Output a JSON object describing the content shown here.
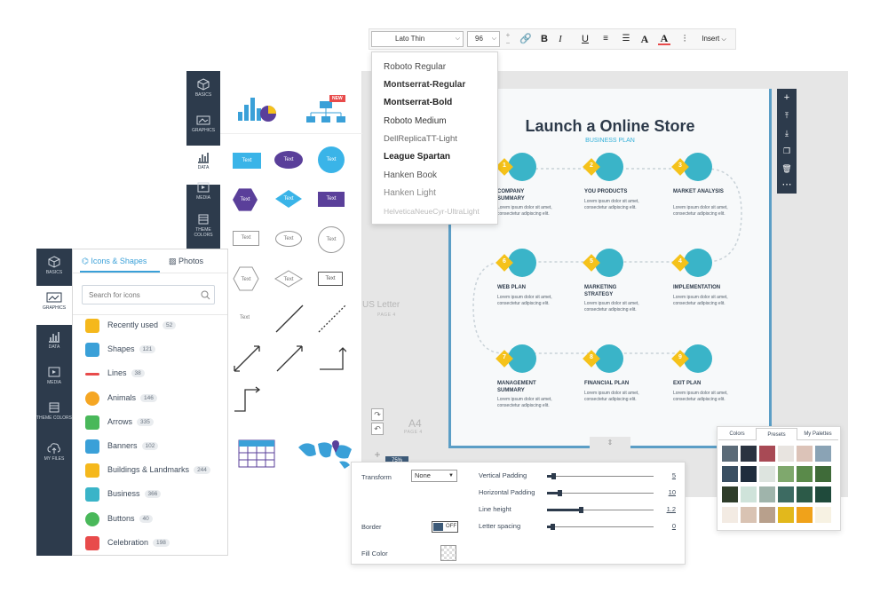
{
  "toolbar": {
    "font_value": "Lato Thin",
    "size_value": "96",
    "bold": "B",
    "italic": "I",
    "underline": "U",
    "text_color": "A",
    "highlight": "A",
    "insert_label": "Insert"
  },
  "font_menu": {
    "items": [
      "Roboto Regular",
      "Montserrat-Regular",
      "Montserrat-Bold",
      "Roboto Medium",
      "DellReplicaTT-Light",
      "League Spartan",
      "Hanken Book",
      "Hanken Light",
      "HelveticaNeueCyr-UltraLight"
    ]
  },
  "back_sidebar": {
    "tabs": [
      "BASICS",
      "GRAPHICS",
      "DATA",
      "MEDIA",
      "THEME COLORS"
    ]
  },
  "shape_panel": {
    "new_badge": "NEW",
    "shape_text": "Text",
    "zoom": "75%"
  },
  "canvas": {
    "letter_label": "US Letter",
    "letter_sub": "PAGE 4",
    "a4_label": "A4",
    "a4_sub": "PAGE 4"
  },
  "infographic": {
    "title": "Launch a Online Store",
    "subtitle": "BUSINESS PLAN",
    "body_text": "Lorem ipsum dolor sit amet, consectetur adipiscing elit.",
    "steps": [
      {
        "num": "1",
        "title": "COMPANY SUMMARY"
      },
      {
        "num": "2",
        "title": "YOU PRODUCTS"
      },
      {
        "num": "3",
        "title": "MARKET ANALYSIS"
      },
      {
        "num": "6",
        "title": "WEB PLAN"
      },
      {
        "num": "5",
        "title": "MARKETING STRATEGY"
      },
      {
        "num": "4",
        "title": "IMPLEMENTATION"
      },
      {
        "num": "7",
        "title": "MANAGEMENT SUMMARY"
      },
      {
        "num": "8",
        "title": "FINANCIAL PLAN"
      },
      {
        "num": "9",
        "title": "EXIT PLAN"
      }
    ]
  },
  "front_sidebar": {
    "tabs": [
      "BASICS",
      "GRAPHICS",
      "DATA",
      "MEDIA",
      "THEME COLORS",
      "MY FILES"
    ]
  },
  "front_panel": {
    "tab_icons": "Icons & Shapes",
    "tab_photos": "Photos",
    "search_placeholder": "Search for icons",
    "categories": [
      {
        "label": "Recently used",
        "count": "52",
        "icon": "star-icon",
        "color": "#f5b81c"
      },
      {
        "label": "Shapes",
        "count": "121",
        "icon": "shapes-icon",
        "color": "#3aa0d8"
      },
      {
        "label": "Lines",
        "count": "38",
        "icon": "line-icon",
        "color": "#e84b4b"
      },
      {
        "label": "Animals",
        "count": "146",
        "icon": "paw-icon",
        "color": "#f5a623"
      },
      {
        "label": "Arrows",
        "count": "335",
        "icon": "arrow-icon",
        "color": "#49b85a"
      },
      {
        "label": "Banners",
        "count": "102",
        "icon": "banner-icon",
        "color": "#3aa0d8"
      },
      {
        "label": "Buildings & Landmarks",
        "count": "244",
        "icon": "building-icon",
        "color": "#f5b81c"
      },
      {
        "label": "Business",
        "count": "366",
        "icon": "briefcase-icon",
        "color": "#3ab4c8"
      },
      {
        "label": "Buttons",
        "count": "40",
        "icon": "facebook-icon",
        "color": "#49b85a"
      },
      {
        "label": "Celebration",
        "count": "198",
        "icon": "party-icon",
        "color": "#e84b4b"
      }
    ]
  },
  "style_panel": {
    "transform_label": "Transform",
    "transform_value": "None",
    "border_label": "Border",
    "border_toggle": "OFF",
    "fill_label": "Fill Color",
    "sliders": [
      {
        "label": "Vertical Padding",
        "value": "5",
        "level": 0.04
      },
      {
        "label": "Horizontal Padding",
        "value": "10",
        "level": 0.1
      },
      {
        "label": "Line height",
        "value": "1.2",
        "level": 0.3
      },
      {
        "label": "Letter spacing",
        "value": "0",
        "level": 0.0
      }
    ]
  },
  "palette": {
    "tabs": [
      "Colors",
      "Presets",
      "My Palettes"
    ],
    "rows": [
      [
        "#5b6b78",
        "#2a3340",
        "#a84a55",
        "#e8e4e0",
        "#dcc3b8",
        "#8aa3b5"
      ],
      [
        "#3a4f62",
        "#1f2d3d",
        "#dde4df",
        "#7fa86d",
        "#5a8a4a",
        "#3f6b39"
      ],
      [
        "#2f3d2a",
        "#cfe3da",
        "#9fb4ab",
        "#3d6b62",
        "#2c5a48",
        "#1f4a3b"
      ],
      [
        "#f3ebe3",
        "#d9c3b3",
        "#b8a08c",
        "#e2b81c",
        "#f0a21a",
        "#f7f2e3"
      ]
    ]
  }
}
